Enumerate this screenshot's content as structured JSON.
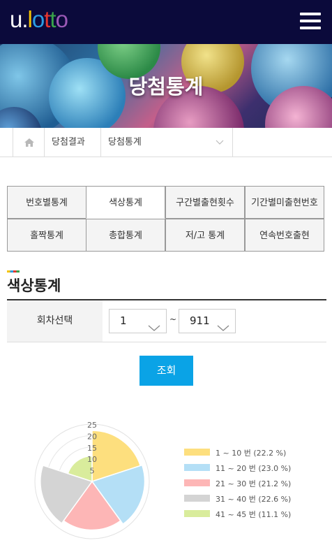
{
  "header": {
    "logo_u": "u",
    "logo_dot": ".",
    "logo_letters": [
      "l",
      "o",
      "t",
      "t",
      "o"
    ],
    "menu_icon": "hamburger-menu-icon"
  },
  "banner": {
    "title": "당첨통계"
  },
  "breadcrumb": {
    "home_icon": "home-icon",
    "item1": "당첨결과",
    "item2": "당첨통계"
  },
  "tabs": [
    {
      "label": "번호별통계",
      "active": false
    },
    {
      "label": "색상통계",
      "active": true
    },
    {
      "label": "구간별출현횟수",
      "active": false
    },
    {
      "label": "기간별미출현번호",
      "active": false
    },
    {
      "label": "홀짝통계",
      "active": false
    },
    {
      "label": "총합통계",
      "active": false
    },
    {
      "label": "저/고 통계",
      "active": false
    },
    {
      "label": "연속번호출현",
      "active": false
    }
  ],
  "section": {
    "title": "색상통계"
  },
  "round": {
    "label": "회차선택",
    "from": "1",
    "separator": "~",
    "to": "911"
  },
  "search_button": "조회",
  "chart_data": {
    "type": "polar-area",
    "radial_ticks": [
      "25",
      "20",
      "15",
      "10",
      "5"
    ],
    "rmax": 25,
    "series": [
      {
        "label": "1 ~ 10 번 (22.2 %)",
        "value": 22.2,
        "color": "#fddf7e"
      },
      {
        "label": "11 ~ 20 번 (23.0 %)",
        "value": 23.0,
        "color": "#b4dff6"
      },
      {
        "label": "21 ~ 30 번 (21.2 %)",
        "value": 21.2,
        "color": "#fdb6b6"
      },
      {
        "label": "31 ~ 40 번 (22.6 %)",
        "value": 22.6,
        "color": "#d4d4d4"
      },
      {
        "label": "41 ~ 45 번 (11.1 %)",
        "value": 11.1,
        "color": "#d9ec9c"
      }
    ]
  }
}
